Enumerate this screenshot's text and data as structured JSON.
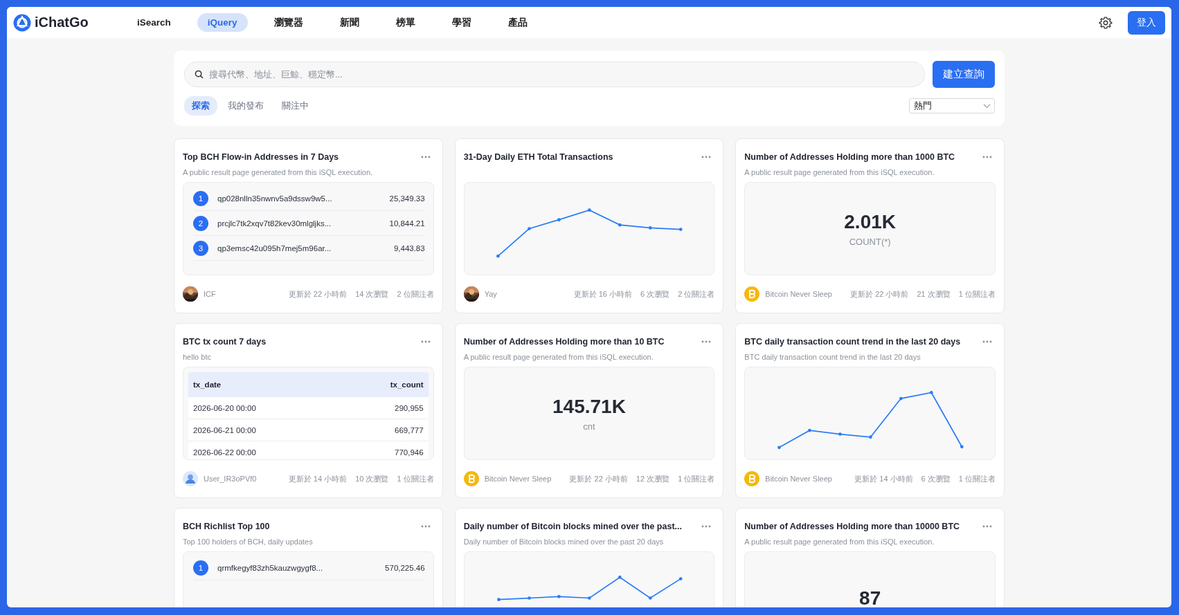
{
  "header": {
    "brand": "iChatGo",
    "nav": [
      {
        "label": "iSearch",
        "selected": false
      },
      {
        "label": "iQuery",
        "selected": true
      },
      {
        "label": "瀏覽器",
        "selected": false
      },
      {
        "label": "新聞",
        "selected": false
      },
      {
        "label": "榜單",
        "selected": false
      },
      {
        "label": "學習",
        "selected": false
      },
      {
        "label": "產品",
        "selected": false
      }
    ],
    "login": "登入"
  },
  "search": {
    "placeholder": "搜尋代幣、地址、巨鯨、穩定幣...",
    "create_button": "建立查詢",
    "tabs": [
      {
        "label": "探索",
        "selected": true
      },
      {
        "label": "我的發布",
        "selected": false
      },
      {
        "label": "關注中",
        "selected": false
      }
    ],
    "sort": "熱門"
  },
  "cards": [
    {
      "kind": "ranking",
      "title": "Top BCH Flow-in Addresses in 7 Days",
      "subtitle": "A public result page generated from this iSQL execution.",
      "rows": [
        {
          "rank": "1",
          "address": "qp028nlln35nwnv5a9dssw9w5...",
          "value": "25,349.33"
        },
        {
          "rank": "2",
          "address": "prcjlc7tk2xqv7t82kev30mlgljks...",
          "value": "10,844.21"
        },
        {
          "rank": "3",
          "address": "qp3emsc42u095h7mej5m96ar...",
          "value": "9,443.83"
        }
      ],
      "author": {
        "name": "ICF"
      },
      "updated": "更新於 22 小時前",
      "views": "14 次瀏覽",
      "followers": "2 位關注者"
    },
    {
      "kind": "line",
      "title": "31-Day Daily ETH Total Transactions",
      "author": {
        "name": "Yay"
      },
      "updated": "更新於 16 小時前",
      "views": "6 次瀏覽",
      "followers": "2 位關注者"
    },
    {
      "kind": "stat",
      "title": "Number of Addresses Holding more than 1000 BTC",
      "subtitle": "A public result page generated from this iSQL execution.",
      "value": "2.01K",
      "label": "COUNT(*)",
      "author": {
        "name": "Bitcoin Never Sleep",
        "kind": "coin"
      },
      "updated": "更新於 22 小時前",
      "views": "21 次瀏覽",
      "followers": "1 位關注者"
    },
    {
      "kind": "table",
      "title": "BTC tx count 7 days",
      "subtitle": "hello btc",
      "columns": [
        "tx_date",
        "tx_count"
      ],
      "rows": [
        [
          "2026-06-20 00:00",
          "290,955"
        ],
        [
          "2026-06-21 00:00",
          "669,777"
        ],
        [
          "2026-06-22 00:00",
          "770,946"
        ]
      ],
      "author": {
        "name": "User_IR3oPVf0",
        "kind": "user"
      },
      "updated": "更新於 14 小時前",
      "views": "10 次瀏覽",
      "followers": "1 位關注者"
    },
    {
      "kind": "stat",
      "title": "Number of Addresses Holding more than 10 BTC",
      "subtitle": "A public result page generated from this iSQL execution.",
      "value": "145.71K",
      "label": "cnt",
      "author": {
        "name": "Bitcoin Never Sleep",
        "kind": "coin"
      },
      "updated": "更新於 22 小時前",
      "views": "12 次瀏覽",
      "followers": "1 位關注者"
    },
    {
      "kind": "line",
      "title": "BTC daily transaction count trend in the last 20 days",
      "subtitle": "BTC daily transaction count trend in the last 20 days",
      "author": {
        "name": "Bitcoin Never Sleep",
        "kind": "coin"
      },
      "updated": "更新於 14 小時前",
      "views": "6 次瀏覽",
      "followers": "1 位關注者"
    },
    {
      "kind": "ranking",
      "title": "BCH Richlist Top 100",
      "subtitle": "Top 100 holders of BCH, daily updates",
      "rows": [
        {
          "rank": "1",
          "address": "qrmfkegyf83zh5kauzwgygf8...",
          "value": "570,225.46"
        }
      ]
    },
    {
      "kind": "line",
      "title": "Daily number of Bitcoin blocks mined over the past...",
      "subtitle": "Daily number of Bitcoin blocks mined over the past 20 days"
    },
    {
      "kind": "stat",
      "title": "Number of Addresses Holding more than 10000 BTC",
      "subtitle": "A public result page generated from this iSQL execution.",
      "value": "87"
    }
  ]
}
